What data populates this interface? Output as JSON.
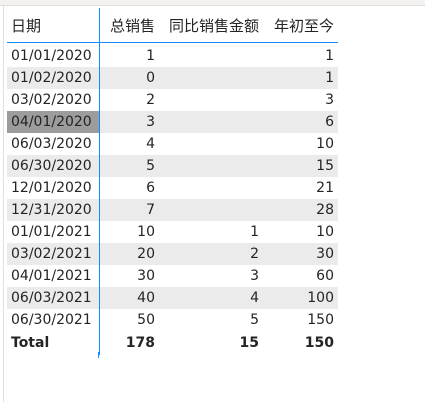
{
  "table": {
    "headers": {
      "date": "日期",
      "total_sales": "总销售",
      "yoy_sales": "同比销售金额",
      "ytd": "年初至今"
    },
    "rows": [
      {
        "date": "01/01/2020",
        "total_sales": "1",
        "yoy_sales": "",
        "ytd": "1"
      },
      {
        "date": "01/02/2020",
        "total_sales": "0",
        "yoy_sales": "",
        "ytd": "1"
      },
      {
        "date": "03/02/2020",
        "total_sales": "2",
        "yoy_sales": "",
        "ytd": "3"
      },
      {
        "date": "04/01/2020",
        "total_sales": "3",
        "yoy_sales": "",
        "ytd": "6"
      },
      {
        "date": "06/03/2020",
        "total_sales": "4",
        "yoy_sales": "",
        "ytd": "10"
      },
      {
        "date": "06/30/2020",
        "total_sales": "5",
        "yoy_sales": "",
        "ytd": "15"
      },
      {
        "date": "12/01/2020",
        "total_sales": "6",
        "yoy_sales": "",
        "ytd": "21"
      },
      {
        "date": "12/31/2020",
        "total_sales": "7",
        "yoy_sales": "",
        "ytd": "28"
      },
      {
        "date": "01/01/2021",
        "total_sales": "10",
        "yoy_sales": "1",
        "ytd": "10"
      },
      {
        "date": "03/02/2021",
        "total_sales": "20",
        "yoy_sales": "2",
        "ytd": "30"
      },
      {
        "date": "04/01/2021",
        "total_sales": "30",
        "yoy_sales": "3",
        "ytd": "60"
      },
      {
        "date": "06/03/2021",
        "total_sales": "40",
        "yoy_sales": "4",
        "ytd": "100"
      },
      {
        "date": "06/30/2021",
        "total_sales": "50",
        "yoy_sales": "5",
        "ytd": "150"
      }
    ],
    "selected_row": 3,
    "totals": {
      "label": "Total",
      "total_sales": "178",
      "yoy_sales": "15",
      "ytd": "150"
    }
  },
  "colors": {
    "accent": "#118dff",
    "alt_row": "#ebebeb",
    "selected_cell": "#9c9c9c"
  }
}
